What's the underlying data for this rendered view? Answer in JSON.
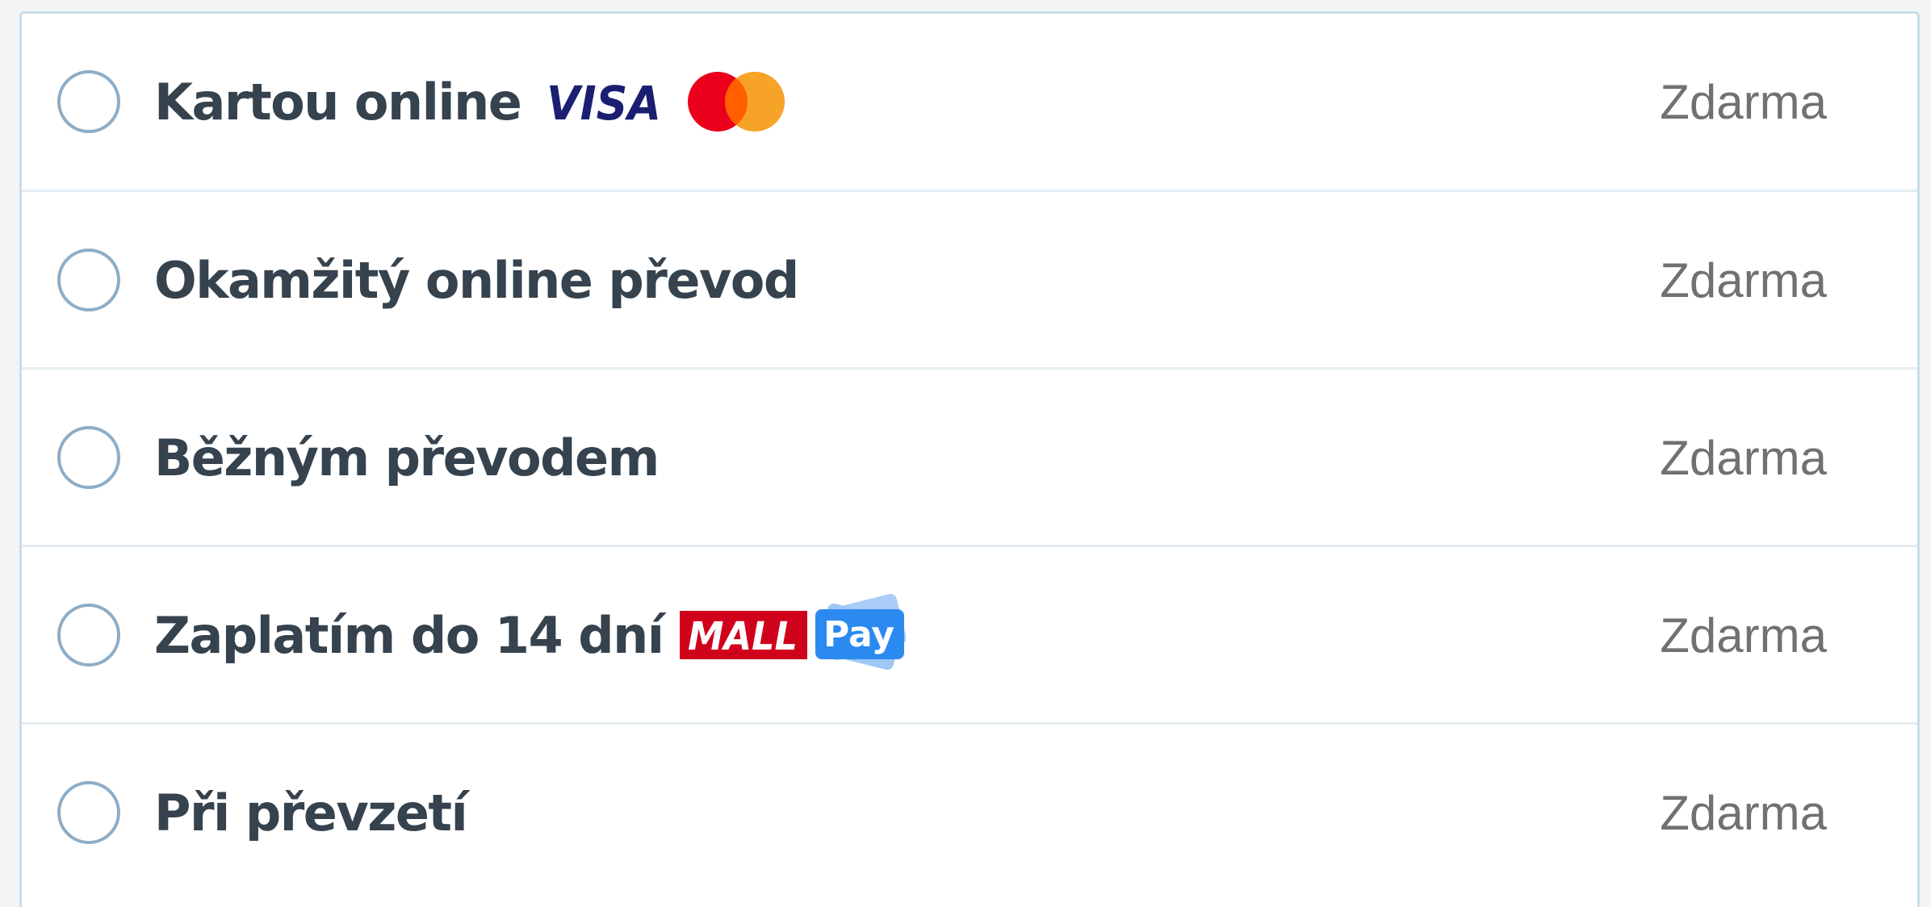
{
  "payment_methods": [
    {
      "label": "Kartou online",
      "price": "Zdarma",
      "logos": [
        "visa-logo",
        "mastercard-logo"
      ],
      "selected": false
    },
    {
      "label": "Okamžitý online převod",
      "price": "Zdarma",
      "logos": [],
      "selected": false
    },
    {
      "label": "Běžným převodem",
      "price": "Zdarma",
      "logos": [],
      "selected": false
    },
    {
      "label": "Zaplatím do 14 dní",
      "price": "Zdarma",
      "logos": [
        "mallpay-logo"
      ],
      "selected": false
    },
    {
      "label": "Při převzetí",
      "price": "Zdarma",
      "logos": [],
      "selected": false
    }
  ],
  "logos": {
    "visa": "VISA",
    "mall": "MALL",
    "pay": "Pay"
  },
  "colors": {
    "radio_border": "#8eadc6",
    "label_text": "#36424d",
    "price_text": "#717171",
    "visa_blue": "#1a1f71",
    "mastercard_red": "#eb001b",
    "mastercard_orange": "#f79e1b",
    "mall_red": "#d0021b",
    "pay_blue": "#2b8af0"
  }
}
